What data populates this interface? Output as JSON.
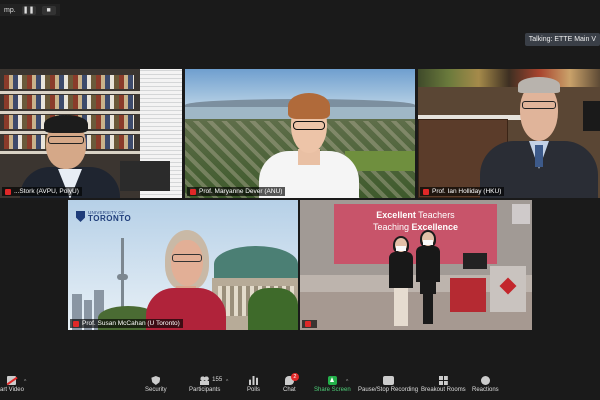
{
  "top_badge": {
    "label": "mp."
  },
  "talking": {
    "label": "Talking: ETTE Main V"
  },
  "tiles": [
    {
      "name": "...Stork (AVPU, PolyU)"
    },
    {
      "name": "Prof. Maryanne Dever (ANU)"
    },
    {
      "name": "Prof. Ian Holliday (HKU)"
    },
    {
      "name": "Prof. Susan McCahan (U Toronto)",
      "logo_small": "UNIVERSITY OF",
      "logo_big": "TORONTO"
    },
    {
      "name": "",
      "slide_title_bold": "Excellent",
      "slide_title_rest": " Teachers",
      "slide_sub_prefix": "Teaching ",
      "slide_sub_bold": "Excellence"
    }
  ],
  "toolbar": {
    "video_label": "art Video",
    "security_label": "Security",
    "participants_label": "Participants",
    "participants_count": "155",
    "polls_label": "Polls",
    "chat_label": "Chat",
    "chat_badge": "2",
    "share_label": "Share Screen",
    "record_label": "Pause/Stop Recording",
    "breakout_label": "Breakout Rooms",
    "reactions_label": "Reactions"
  },
  "colors": {
    "active_speaker_border": "#d9e03a",
    "share_green": "#23b04a",
    "mic_muted_red": "#e02828"
  }
}
